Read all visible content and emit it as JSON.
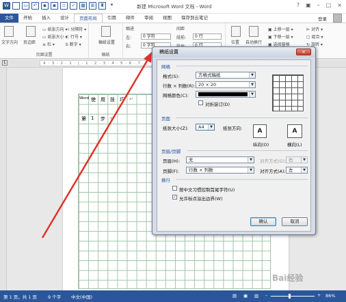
{
  "window": {
    "title": "新建 Microsoft Word 文档 - Word",
    "controls": [
      "?",
      "▣",
      "–",
      "□",
      "×"
    ],
    "login": "登录"
  },
  "tabs": [
    {
      "label": "文件"
    },
    {
      "label": "开始"
    },
    {
      "label": "插入"
    },
    {
      "label": "设计"
    },
    {
      "label": "页面布局"
    },
    {
      "label": "引用"
    },
    {
      "label": "邮件"
    },
    {
      "label": "审阅"
    },
    {
      "label": "视图"
    },
    {
      "label": "保存到云笔记"
    }
  ],
  "ribbon": {
    "text_direction": "文字方向",
    "margins": "页边距",
    "orientation": "纸张方向",
    "size": "纸张大小",
    "columns": "栏",
    "breaks": "分隔符",
    "line_numbers": "行号",
    "hyphenation": "断字",
    "page_setup_group": "页面设置",
    "draft_paper": "稿纸设置",
    "draft_group": "稿纸",
    "indent_label": "缩进",
    "spacing_label": "间距",
    "indent_left": "左:",
    "indent_right": "右:",
    "indent_left_val": "0 字符",
    "indent_right_val": "0 字符",
    "spacing_before": "段前:",
    "spacing_after": "段后:",
    "spacing_before_val": "0 行",
    "spacing_after_val": "0 行",
    "paragraph_group": "段落",
    "position": "位置",
    "wrap_text": "自动换行",
    "bring_forward": "上移一层",
    "send_backward": "下移一层",
    "selection_pane": "选择窗格",
    "align": "对齐",
    "group": "组合",
    "rotate": "旋转",
    "arrange_group": "排列"
  },
  "ruler_text": "4 · 3 · 2 · 1 · | · 1 · 2 · 3 · 4 · 5 · 6 · 7",
  "document": {
    "row1": [
      "Word",
      "使",
      "用",
      "技",
      "巧",
      "↵"
    ],
    "row2": [
      "第",
      "1",
      "步",
      "↵"
    ]
  },
  "dialog": {
    "title": "稿纸设置",
    "close": "×",
    "section_grid": "网格",
    "format_label": "格式(S):",
    "format_value": "方格式稿纸",
    "rows_cols_label": "行数 × 列数(R):",
    "rows_cols_value": "20 × 20",
    "grid_color_label": "网格颜色(C):",
    "grid_color_value": "#000000",
    "alt_binding": "对折装订(D)",
    "alt_binding_checked": false,
    "section_page": "页面",
    "paper_size_label": "纸张大小(Z):",
    "paper_size_value": "A4",
    "orientation_label": "纸张方向:",
    "portrait_label": "纵向(O)",
    "landscape_label": "横向(L)",
    "section_header_footer": "页眉/页脚",
    "header_label": "页眉(H):",
    "header_value": "无",
    "header_align_label": "对齐方式(G):",
    "header_align_value": "右",
    "footer_label": "页脚(F):",
    "footer_value": "行数 × 列数",
    "footer_align_label": "对齐方式(A):",
    "footer_align_value": "左",
    "section_wrap": "换行",
    "opt1": "按中文习惯控制首尾字符(U)",
    "opt1_checked": false,
    "opt2": "允许标点溢出边界(W)",
    "opt2_checked": true,
    "ok": "确认",
    "cancel": "取消"
  },
  "status": {
    "page": "第 1 页，共 1 页",
    "words": "9 个字",
    "language": "中文(中国)",
    "zoom": "86%",
    "zoom_value": 86
  },
  "watermark": "Bai经验",
  "colors": {
    "accent": "#2b579a",
    "arrow": "#e0322a",
    "grid_lines": "#9fc4a6"
  }
}
